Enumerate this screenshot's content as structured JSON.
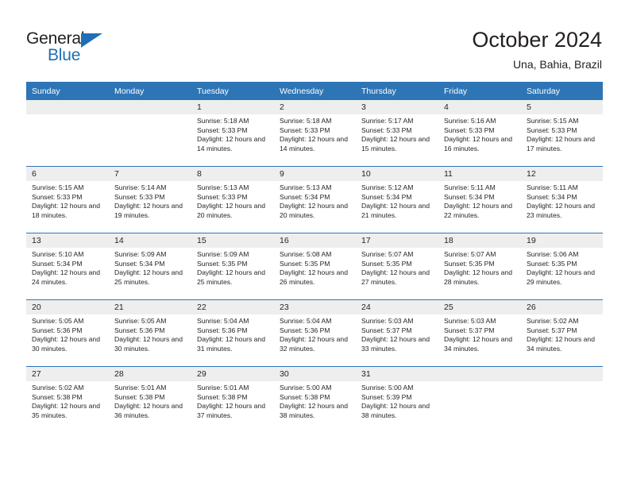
{
  "brand": {
    "name_part1": "General",
    "name_part2": "Blue",
    "accent_color": "#1f6fb4"
  },
  "header": {
    "title": "October 2024",
    "subtitle": "Una, Bahia, Brazil"
  },
  "theme": {
    "header_blue": "#2e75b6",
    "daynum_gray": "#eeeeee",
    "text": "#231f20"
  },
  "weekdays": [
    "Sunday",
    "Monday",
    "Tuesday",
    "Wednesday",
    "Thursday",
    "Friday",
    "Saturday"
  ],
  "labels": {
    "sunrise_prefix": "Sunrise:",
    "sunset_prefix": "Sunset:",
    "daylight_prefix": "Daylight:"
  },
  "weeks": [
    {
      "days": [
        {
          "date": "",
          "empty": true
        },
        {
          "date": "",
          "empty": true
        },
        {
          "date": "1",
          "sunrise": "Sunrise: 5:18 AM",
          "sunset": "Sunset: 5:33 PM",
          "daylight": "Daylight: 12 hours and 14 minutes."
        },
        {
          "date": "2",
          "sunrise": "Sunrise: 5:18 AM",
          "sunset": "Sunset: 5:33 PM",
          "daylight": "Daylight: 12 hours and 14 minutes."
        },
        {
          "date": "3",
          "sunrise": "Sunrise: 5:17 AM",
          "sunset": "Sunset: 5:33 PM",
          "daylight": "Daylight: 12 hours and 15 minutes."
        },
        {
          "date": "4",
          "sunrise": "Sunrise: 5:16 AM",
          "sunset": "Sunset: 5:33 PM",
          "daylight": "Daylight: 12 hours and 16 minutes."
        },
        {
          "date": "5",
          "sunrise": "Sunrise: 5:15 AM",
          "sunset": "Sunset: 5:33 PM",
          "daylight": "Daylight: 12 hours and 17 minutes."
        }
      ]
    },
    {
      "days": [
        {
          "date": "6",
          "sunrise": "Sunrise: 5:15 AM",
          "sunset": "Sunset: 5:33 PM",
          "daylight": "Daylight: 12 hours and 18 minutes."
        },
        {
          "date": "7",
          "sunrise": "Sunrise: 5:14 AM",
          "sunset": "Sunset: 5:33 PM",
          "daylight": "Daylight: 12 hours and 19 minutes."
        },
        {
          "date": "8",
          "sunrise": "Sunrise: 5:13 AM",
          "sunset": "Sunset: 5:33 PM",
          "daylight": "Daylight: 12 hours and 20 minutes."
        },
        {
          "date": "9",
          "sunrise": "Sunrise: 5:13 AM",
          "sunset": "Sunset: 5:34 PM",
          "daylight": "Daylight: 12 hours and 20 minutes."
        },
        {
          "date": "10",
          "sunrise": "Sunrise: 5:12 AM",
          "sunset": "Sunset: 5:34 PM",
          "daylight": "Daylight: 12 hours and 21 minutes."
        },
        {
          "date": "11",
          "sunrise": "Sunrise: 5:11 AM",
          "sunset": "Sunset: 5:34 PM",
          "daylight": "Daylight: 12 hours and 22 minutes."
        },
        {
          "date": "12",
          "sunrise": "Sunrise: 5:11 AM",
          "sunset": "Sunset: 5:34 PM",
          "daylight": "Daylight: 12 hours and 23 minutes."
        }
      ]
    },
    {
      "days": [
        {
          "date": "13",
          "sunrise": "Sunrise: 5:10 AM",
          "sunset": "Sunset: 5:34 PM",
          "daylight": "Daylight: 12 hours and 24 minutes."
        },
        {
          "date": "14",
          "sunrise": "Sunrise: 5:09 AM",
          "sunset": "Sunset: 5:34 PM",
          "daylight": "Daylight: 12 hours and 25 minutes."
        },
        {
          "date": "15",
          "sunrise": "Sunrise: 5:09 AM",
          "sunset": "Sunset: 5:35 PM",
          "daylight": "Daylight: 12 hours and 25 minutes."
        },
        {
          "date": "16",
          "sunrise": "Sunrise: 5:08 AM",
          "sunset": "Sunset: 5:35 PM",
          "daylight": "Daylight: 12 hours and 26 minutes."
        },
        {
          "date": "17",
          "sunrise": "Sunrise: 5:07 AM",
          "sunset": "Sunset: 5:35 PM",
          "daylight": "Daylight: 12 hours and 27 minutes."
        },
        {
          "date": "18",
          "sunrise": "Sunrise: 5:07 AM",
          "sunset": "Sunset: 5:35 PM",
          "daylight": "Daylight: 12 hours and 28 minutes."
        },
        {
          "date": "19",
          "sunrise": "Sunrise: 5:06 AM",
          "sunset": "Sunset: 5:35 PM",
          "daylight": "Daylight: 12 hours and 29 minutes."
        }
      ]
    },
    {
      "days": [
        {
          "date": "20",
          "sunrise": "Sunrise: 5:05 AM",
          "sunset": "Sunset: 5:36 PM",
          "daylight": "Daylight: 12 hours and 30 minutes."
        },
        {
          "date": "21",
          "sunrise": "Sunrise: 5:05 AM",
          "sunset": "Sunset: 5:36 PM",
          "daylight": "Daylight: 12 hours and 30 minutes."
        },
        {
          "date": "22",
          "sunrise": "Sunrise: 5:04 AM",
          "sunset": "Sunset: 5:36 PM",
          "daylight": "Daylight: 12 hours and 31 minutes."
        },
        {
          "date": "23",
          "sunrise": "Sunrise: 5:04 AM",
          "sunset": "Sunset: 5:36 PM",
          "daylight": "Daylight: 12 hours and 32 minutes."
        },
        {
          "date": "24",
          "sunrise": "Sunrise: 5:03 AM",
          "sunset": "Sunset: 5:37 PM",
          "daylight": "Daylight: 12 hours and 33 minutes."
        },
        {
          "date": "25",
          "sunrise": "Sunrise: 5:03 AM",
          "sunset": "Sunset: 5:37 PM",
          "daylight": "Daylight: 12 hours and 34 minutes."
        },
        {
          "date": "26",
          "sunrise": "Sunrise: 5:02 AM",
          "sunset": "Sunset: 5:37 PM",
          "daylight": "Daylight: 12 hours and 34 minutes."
        }
      ]
    },
    {
      "days": [
        {
          "date": "27",
          "sunrise": "Sunrise: 5:02 AM",
          "sunset": "Sunset: 5:38 PM",
          "daylight": "Daylight: 12 hours and 35 minutes."
        },
        {
          "date": "28",
          "sunrise": "Sunrise: 5:01 AM",
          "sunset": "Sunset: 5:38 PM",
          "daylight": "Daylight: 12 hours and 36 minutes."
        },
        {
          "date": "29",
          "sunrise": "Sunrise: 5:01 AM",
          "sunset": "Sunset: 5:38 PM",
          "daylight": "Daylight: 12 hours and 37 minutes."
        },
        {
          "date": "30",
          "sunrise": "Sunrise: 5:00 AM",
          "sunset": "Sunset: 5:38 PM",
          "daylight": "Daylight: 12 hours and 38 minutes."
        },
        {
          "date": "31",
          "sunrise": "Sunrise: 5:00 AM",
          "sunset": "Sunset: 5:39 PM",
          "daylight": "Daylight: 12 hours and 38 minutes."
        },
        {
          "date": "",
          "empty": true
        },
        {
          "date": "",
          "empty": true
        }
      ]
    }
  ]
}
